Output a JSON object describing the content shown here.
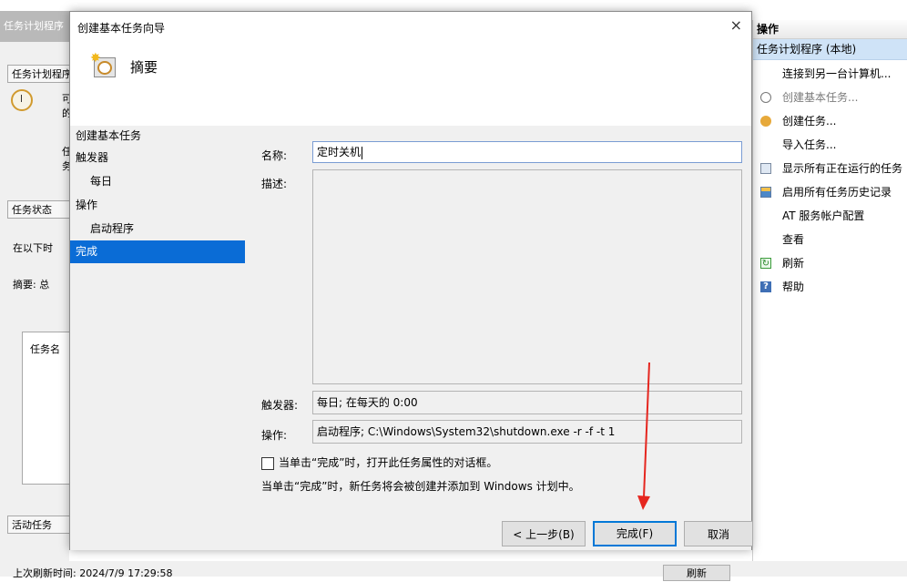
{
  "background": {
    "title_partial": "任务计划程序",
    "section_overview": "任务计划程序",
    "clock_text_1": "可",
    "clock_text_2": "的",
    "overview_text_1": "任",
    "overview_text_2": "务",
    "section_status": "任务状态",
    "status_line": "在以下时",
    "summary_line": "摘要: 总",
    "task_name_col": "任务名",
    "section_active": "活动任务",
    "last_refresh": "上次刷新时间: 2024/7/9 17:29:58",
    "refresh_button": "刷新"
  },
  "actions_pane": {
    "header": "操作",
    "subheader": "任务计划程序 (本地)",
    "items": [
      {
        "label": "连接到另一台计算机...",
        "icon": "none",
        "disabled": false
      },
      {
        "label": "创建基本任务...",
        "icon": "wizard-icon",
        "disabled": true
      },
      {
        "label": "创建任务...",
        "icon": "task-icon",
        "disabled": false
      },
      {
        "label": "导入任务...",
        "icon": "none",
        "disabled": false
      },
      {
        "label": "显示所有正在运行的任务",
        "icon": "running-tasks-icon",
        "disabled": false
      },
      {
        "label": "启用所有任务历史记录",
        "icon": "history-icon",
        "disabled": false
      },
      {
        "label": "AT 服务帐户配置",
        "icon": "none",
        "disabled": false
      },
      {
        "label": "查看",
        "icon": "none",
        "disabled": false
      },
      {
        "label": "刷新",
        "icon": "refresh-icon",
        "disabled": false
      },
      {
        "label": "帮助",
        "icon": "help-icon",
        "disabled": false
      }
    ]
  },
  "dialog": {
    "title": "创建基本任务向导",
    "heading": "摘要",
    "close_glyph": "×",
    "steps": [
      {
        "label": "创建基本任务",
        "sub": false,
        "active": false
      },
      {
        "label": "触发器",
        "sub": false,
        "active": false
      },
      {
        "label": "每日",
        "sub": true,
        "active": false
      },
      {
        "label": "操作",
        "sub": false,
        "active": false
      },
      {
        "label": "启动程序",
        "sub": true,
        "active": false
      },
      {
        "label": "完成",
        "sub": false,
        "active": true
      }
    ],
    "name_label": "名称:",
    "name_value": "定时关机",
    "desc_label": "描述:",
    "desc_value": "",
    "trigger_label": "触发器:",
    "trigger_value": "每日; 在每天的 0:00",
    "action_label": "操作:",
    "action_value": "启动程序; C:\\Windows\\System32\\shutdown.exe -r -f -t 1",
    "checkbox_label": "当单击“完成”时，打开此任务属性的对话框。",
    "checkbox_checked": false,
    "note": "当单击“完成”时，新任务将会被创建并添加到 Windows 计划中。",
    "back_button": "< 上一步(B)",
    "finish_button": "完成(F)",
    "cancel_button": "取消"
  },
  "colors": {
    "accent": "#0078d7",
    "selection": "#0a6cd6",
    "annotation_arrow": "#e5261f"
  }
}
